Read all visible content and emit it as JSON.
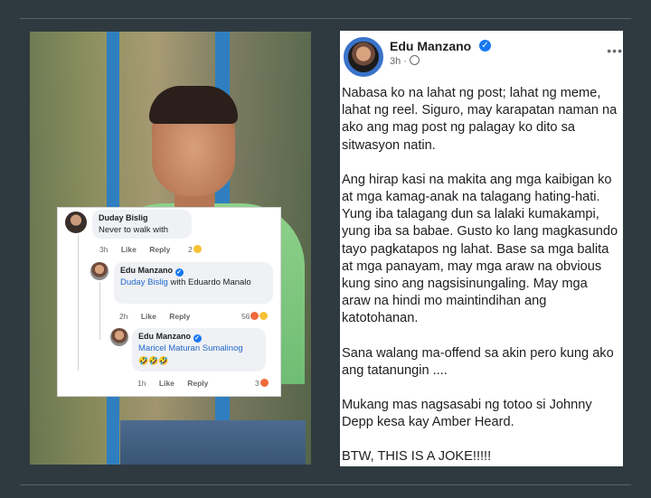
{
  "comments": {
    "c1": {
      "author": "Duday Bislig",
      "text": "Never to walk with",
      "time": "3h",
      "like": "Like",
      "reply": "Reply",
      "reactions": "2"
    },
    "c2": {
      "author": "Edu Manzano",
      "mention": "Duday Bislig",
      "text": " with Eduardo Manalo",
      "time": "2h",
      "like": "Like",
      "reply": "Reply",
      "reactions": "56"
    },
    "c3": {
      "author": "Edu Manzano",
      "mention": "Maricel Maturan Sumalinog",
      "text": "🤣🤣🤣",
      "time": "1h",
      "like": "Like",
      "reply": "Reply",
      "reactions": "3"
    }
  },
  "post": {
    "author": "Edu Manzano",
    "time": "3h",
    "more": "•••",
    "paragraphs": [
      "Nabasa ko na lahat ng post; lahat ng meme, lahat ng reel. Siguro, may karapatan naman na ako ang mag post ng palagay ko dito sa sitwasyon natin.",
      "Ang hirap kasi na makita ang mga kaibigan ko at mga kamag-anak na talagang hating-hati. Yung iba talagang dun sa lalaki kumakampi, yung iba sa babae. Gusto ko lang magkasundo tayo pagkatapos ng lahat. Base sa mga balita at mga panayam, may mga araw na obvious kung sino ang nagsisinungaling. May mga araw na hindi mo maintindihan ang katotohanan.",
      "Sana walang ma-offend sa akin pero kung ako ang tatanungin ....",
      "Mukang mas nagsasabi ng totoo si Johnny Depp kesa kay Amber Heard.",
      "BTW, THIS IS A JOKE!!!!!"
    ]
  },
  "colors": {
    "link": "#2168cc",
    "verified": "#1877f2",
    "background": "#2f3a40"
  }
}
